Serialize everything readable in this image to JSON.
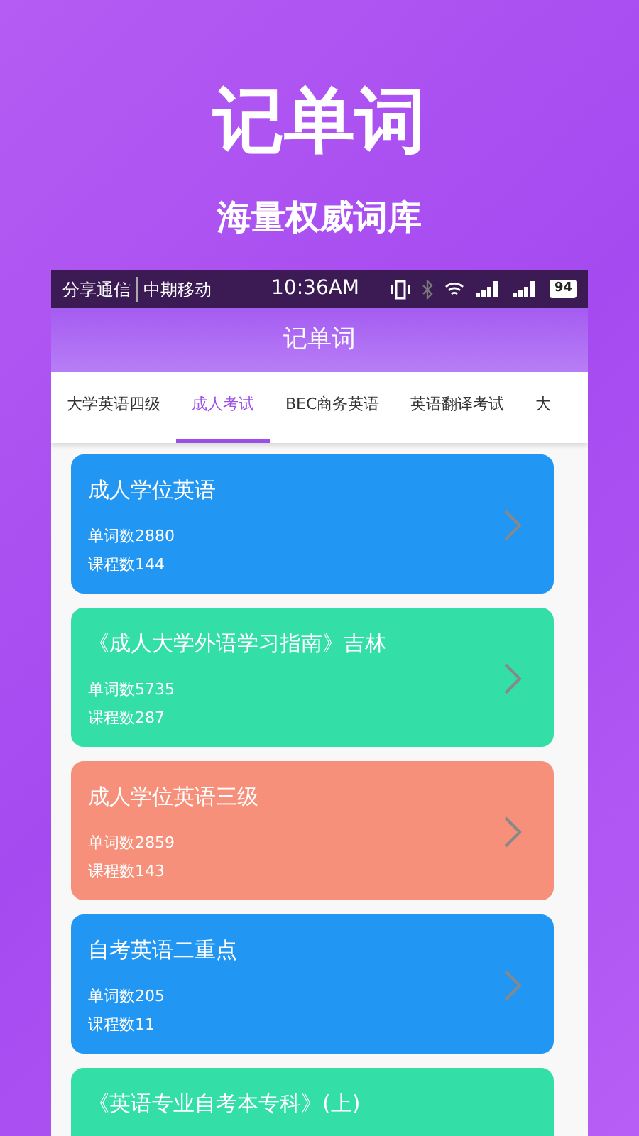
{
  "promo": {
    "title": "记单词",
    "subtitle": "海量权威词库"
  },
  "status_bar": {
    "carrier_1": "分享通信",
    "carrier_2": "中期移动",
    "time": "10:36AM",
    "battery": "94"
  },
  "app_bar": {
    "title": "记单词"
  },
  "tabs": [
    {
      "label": "大学英语四级",
      "selected": false
    },
    {
      "label": "成人考试",
      "selected": true
    },
    {
      "label": "BEC商务英语",
      "selected": false
    },
    {
      "label": "英语翻译考试",
      "selected": false
    },
    {
      "label": "大",
      "selected": false
    }
  ],
  "courses": [
    {
      "title": "成人学位英语",
      "words": "单词数2880",
      "lessons": "课程数144",
      "color": "#2196f3"
    },
    {
      "title": "《成人大学外语学习指南》吉林",
      "words": "单词数5735",
      "lessons": "课程数287",
      "color": "#33dfa6"
    },
    {
      "title": "成人学位英语三级",
      "words": "单词数2859",
      "lessons": "课程数143",
      "color": "#f7907a"
    },
    {
      "title": "自考英语二重点",
      "words": "单词数205",
      "lessons": "课程数11",
      "color": "#2196f3"
    },
    {
      "title": "《英语专业自考本专科》(上)",
      "color": "#33dfa6"
    }
  ]
}
